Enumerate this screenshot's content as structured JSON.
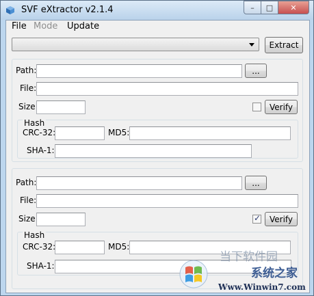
{
  "window": {
    "title": "SVF eXtractor  v2.1.4",
    "controls": {
      "minimize": "–",
      "maximize": "□",
      "close": "✕"
    }
  },
  "menu": [
    {
      "label": "File",
      "enabled": true
    },
    {
      "label": "Mode",
      "enabled": false
    },
    {
      "label": "Update",
      "enabled": true
    }
  ],
  "top": {
    "combo_value": "",
    "extract_label": "Extract"
  },
  "sections": [
    {
      "path_label": "Path:",
      "path_value": "",
      "browse_label": "...",
      "file_label": "File:",
      "file_value": "",
      "size_label": "Size:",
      "size_value": "",
      "verify_checked": false,
      "verify_label": "Verify",
      "hash_group_label": "Hash",
      "crc_label": "CRC-32:",
      "crc_value": "",
      "md5_label": "MD5:",
      "md5_value": "",
      "sha1_label": "SHA-1:",
      "sha1_value": ""
    },
    {
      "path_label": "Path:",
      "path_value": "",
      "browse_label": "...",
      "file_label": "File:",
      "file_value": "",
      "size_label": "Size:",
      "size_value": "",
      "verify_checked": true,
      "verify_label": "Verify",
      "hash_group_label": "Hash",
      "crc_label": "CRC-32:",
      "crc_value": "",
      "md5_label": "MD5:",
      "md5_value": "",
      "sha1_label": "SHA-1:",
      "sha1_value": ""
    }
  ],
  "watermark": {
    "line1": "当下软件园",
    "line2": "系统之家",
    "line3": "Www.Winwin7.com"
  }
}
